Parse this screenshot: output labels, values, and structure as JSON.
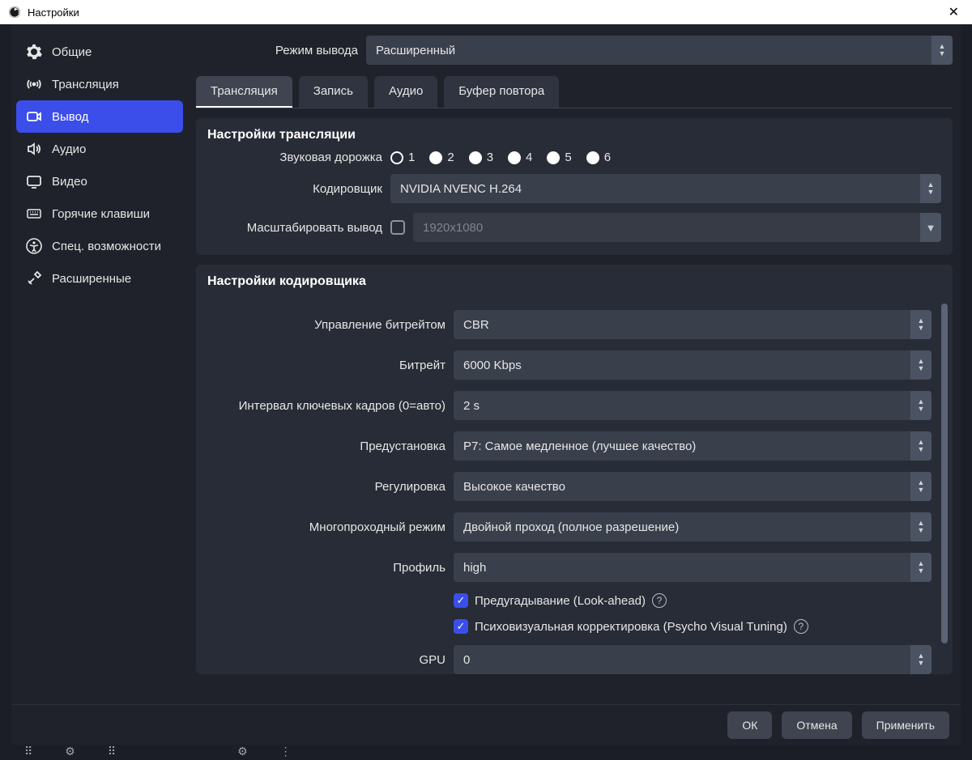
{
  "window": {
    "title": "Настройки"
  },
  "sidebar": {
    "items": [
      {
        "label": "Общие"
      },
      {
        "label": "Трансляция"
      },
      {
        "label": "Вывод"
      },
      {
        "label": "Аудио"
      },
      {
        "label": "Видео"
      },
      {
        "label": "Горячие клавиши"
      },
      {
        "label": "Спец. возможности"
      },
      {
        "label": "Расширенные"
      }
    ]
  },
  "top": {
    "mode_label": "Режим вывода",
    "mode_value": "Расширенный"
  },
  "tabs": {
    "stream": "Трансляция",
    "record": "Запись",
    "audio": "Аудио",
    "replay": "Буфер повтора"
  },
  "stream_panel": {
    "title": "Настройки трансляции",
    "audio_track_label": "Звуковая дорожка",
    "tracks": [
      "1",
      "2",
      "3",
      "4",
      "5",
      "6"
    ],
    "selected_track_index": 0,
    "encoder_label": "Кодировщик",
    "encoder_value": "NVIDIA NVENC H.264",
    "rescale_label": "Масштабировать вывод",
    "rescale_checked": false,
    "rescale_placeholder": "1920x1080"
  },
  "encoder_panel": {
    "title": "Настройки кодировщика",
    "rate_control_label": "Управление битрейтом",
    "rate_control_value": "CBR",
    "bitrate_label": "Битрейт",
    "bitrate_value": "6000 Kbps",
    "keyint_label": "Интервал ключевых кадров (0=авто)",
    "keyint_value": "2 s",
    "preset_label": "Предустановка",
    "preset_value": "P7: Самое медленное (лучшее качество)",
    "tuning_label": "Регулировка",
    "tuning_value": "Высокое качество",
    "multipass_label": "Многопроходный режим",
    "multipass_value": "Двойной проход (полное разрешение)",
    "profile_label": "Профиль",
    "profile_value": "high",
    "lookahead_label": "Предугадывание (Look-ahead)",
    "lookahead_checked": true,
    "psycho_label": "Психовизуальная корректировка (Psycho Visual Tuning)",
    "psycho_checked": true,
    "gpu_label": "GPU",
    "gpu_value": "0"
  },
  "footer": {
    "ok": "ОК",
    "cancel": "Отмена",
    "apply": "Применить"
  }
}
